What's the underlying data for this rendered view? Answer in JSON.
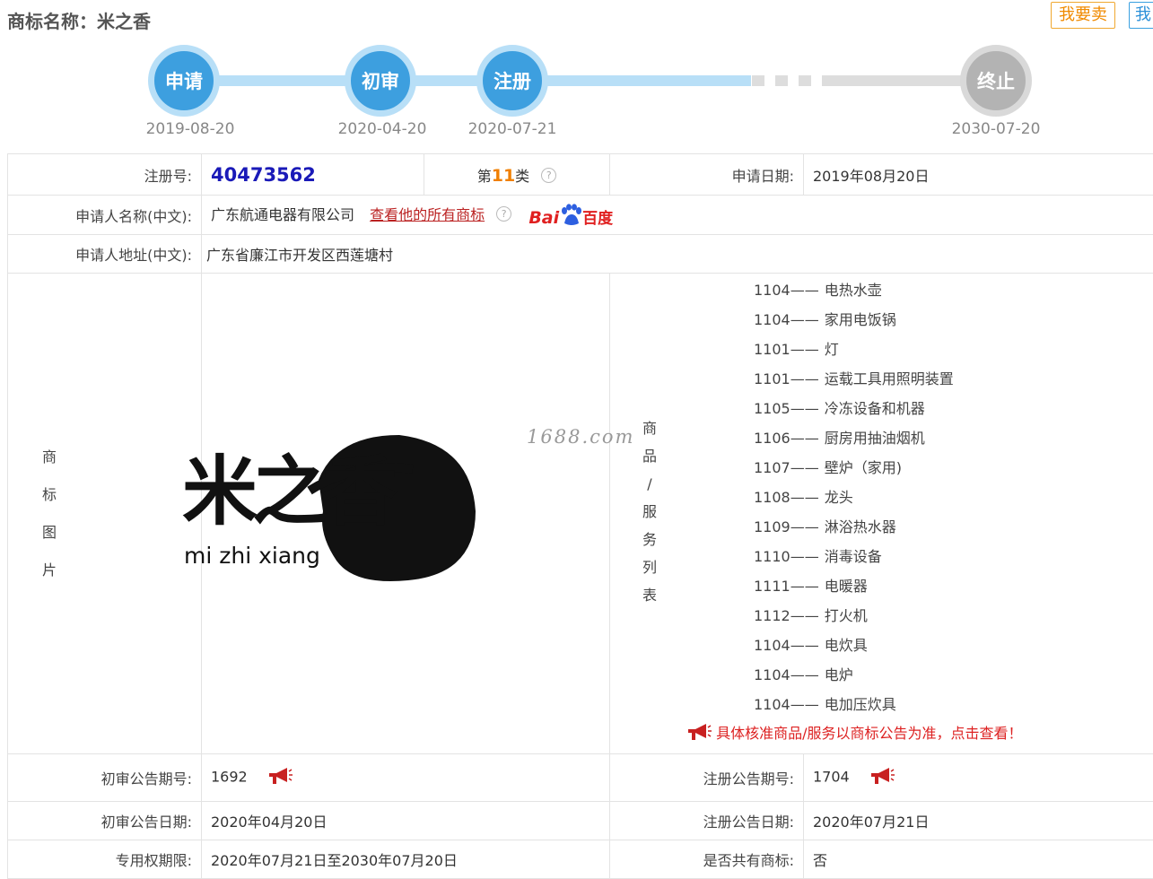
{
  "page": {
    "title": "商标名称：米之香",
    "sell_button": "我要卖",
    "buy_button": "我"
  },
  "timeline": {
    "steps": [
      {
        "label": "申请",
        "date": "2019-08-20"
      },
      {
        "label": "初审",
        "date": "2020-04-20"
      },
      {
        "label": "注册",
        "date": "2020-07-21"
      },
      {
        "label": "终止",
        "date": "2030-07-20"
      }
    ]
  },
  "info": {
    "reg_no_label": "注册号:",
    "reg_no": "40473562",
    "class_prefix": "第",
    "class_num": "11",
    "class_suffix": "类",
    "apply_date_label": "申请日期:",
    "apply_date": "2019年08月20日",
    "applicant_label": "申请人名称(中文):",
    "applicant": "广东航通电器有限公司",
    "view_all_link": "查看他的所有商标",
    "baidu_text": "Bai",
    "baidu_cn": "百度",
    "address_label": "申请人地址(中文):",
    "address": "广东省廉江市开发区西莲塘村",
    "image_label_chars": [
      "商",
      "标",
      "图",
      "片"
    ],
    "logo_cn": "米之香",
    "logo_pinyin": "mi zhi xiang",
    "watermark": "1688.com",
    "goods_label_chars": [
      "商",
      "品",
      "/",
      "服",
      "务",
      "列",
      "表"
    ],
    "goods": [
      {
        "code": "1104",
        "name": "电热水壶"
      },
      {
        "code": "1104",
        "name": "家用电饭锅"
      },
      {
        "code": "1101",
        "name": "灯"
      },
      {
        "code": "1101",
        "name": "运载工具用照明装置"
      },
      {
        "code": "1105",
        "name": "冷冻设备和机器"
      },
      {
        "code": "1106",
        "name": "厨房用抽油烟机"
      },
      {
        "code": "1107",
        "name": "壁炉（家用)"
      },
      {
        "code": "1108",
        "name": "龙头"
      },
      {
        "code": "1109",
        "name": "淋浴热水器"
      },
      {
        "code": "1110",
        "name": "消毒设备"
      },
      {
        "code": "1111",
        "name": "电暖器"
      },
      {
        "code": "1112",
        "name": "打火机"
      },
      {
        "code": "1104",
        "name": "电炊具"
      },
      {
        "code": "1104",
        "name": "电炉"
      },
      {
        "code": "1104",
        "name": "电加压炊具"
      }
    ],
    "goods_separator": "——",
    "notice": "具体核准商品/服务以商标公告为准，点击查看！",
    "prelim_no_label": "初审公告期号:",
    "prelim_no": "1692",
    "reg_pub_no_label": "注册公告期号:",
    "reg_pub_no": "1704",
    "prelim_date_label": "初审公告日期:",
    "prelim_date": "2020年04月20日",
    "reg_pub_date_label": "注册公告日期:",
    "reg_pub_date": "2020年07月21日",
    "exclusive_label": "专用权期限:",
    "exclusive": "2020年07月21日至2030年07月20日",
    "shared_label": "是否共有商标:",
    "shared": "否"
  },
  "colors": {
    "accent_blue": "#3d9fdf",
    "reg_no": "#1a1ab8",
    "class_num": "#f07f00",
    "notice_red": "#d22222"
  }
}
